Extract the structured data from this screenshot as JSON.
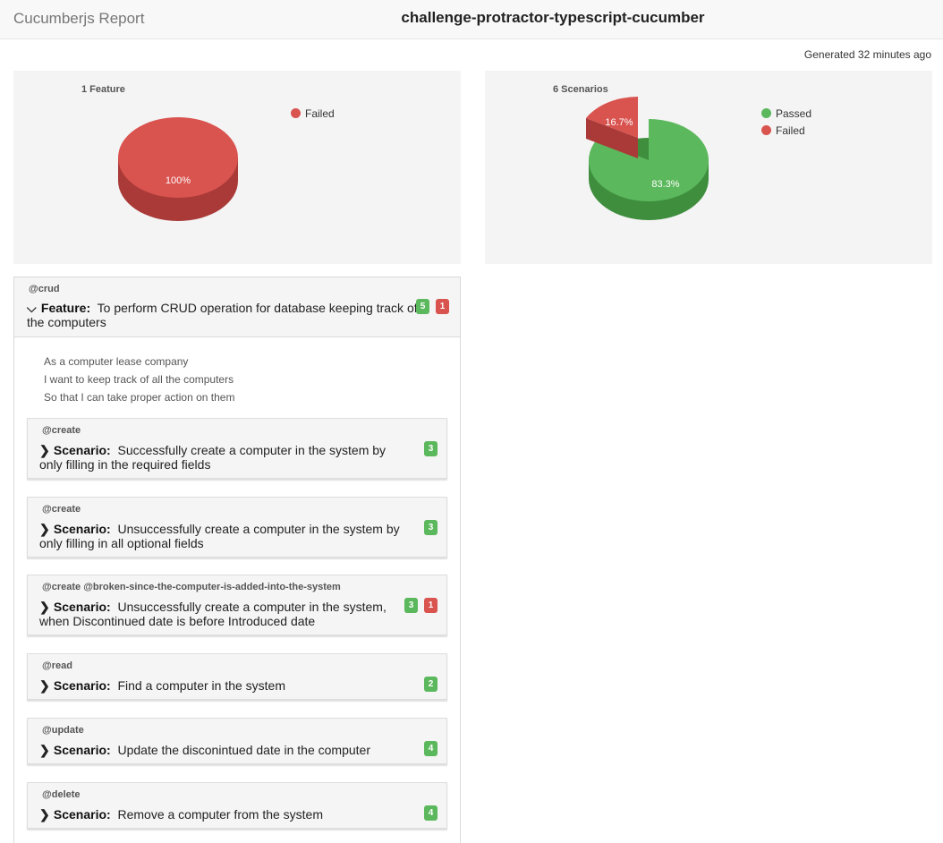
{
  "header": {
    "brand": "Cucumberjs Report",
    "title": "challenge-protractor-typescript-cucumber"
  },
  "generated": "Generated 32 minutes ago",
  "colors": {
    "passed": "#5cb85c",
    "failed": "#d9534f"
  },
  "features_chart": {
    "title": "1 Feature",
    "legend": [
      "Failed"
    ],
    "slice_label": "100%"
  },
  "scenarios_chart": {
    "title": "6 Scenarios",
    "legend": [
      "Passed",
      "Failed"
    ],
    "passed_label": "83.3%",
    "failed_label": "16.7%"
  },
  "chart_data": [
    {
      "type": "pie",
      "title": "1 Feature",
      "categories": [
        "Failed"
      ],
      "values": [
        100
      ],
      "labels": [
        "100%"
      ],
      "legend": "top-right"
    },
    {
      "type": "pie",
      "title": "6 Scenarios",
      "categories": [
        "Passed",
        "Failed"
      ],
      "values": [
        83.3,
        16.7
      ],
      "labels": [
        "83.3%",
        "16.7%"
      ],
      "legend": "top-right"
    }
  ],
  "feature": {
    "tag": "@crud",
    "keyword": "Feature:",
    "name": "To perform CRUD operation for database keeping track of the computers",
    "passed": "5",
    "failed": "1",
    "description": [
      "As a computer lease company",
      "I want to keep track of all the computers",
      "So that I can take proper action on them"
    ]
  },
  "scenarios": [
    {
      "tag": "@create",
      "keyword": "Scenario:",
      "name": "Successfully create a computer in the system by only filling in the required fields",
      "passed": "3"
    },
    {
      "tag": "@create",
      "keyword": "Scenario:",
      "name": "Unsuccessfully create a computer in the system by only filling in all optional fields",
      "passed": "3"
    },
    {
      "tag": "@create @broken-since-the-computer-is-added-into-the-system",
      "keyword": "Scenario:",
      "name": "Unsuccessfully create a computer in the system, when Discontinued date is before Introduced date",
      "passed": "3",
      "failed": "1"
    },
    {
      "tag": "@read",
      "keyword": "Scenario:",
      "name": "Find a computer in the system",
      "passed": "2"
    },
    {
      "tag": "@update",
      "keyword": "Scenario:",
      "name": "Update the disconintued date in the computer",
      "passed": "4"
    },
    {
      "tag": "@delete",
      "keyword": "Scenario:",
      "name": "Remove a computer from the system",
      "passed": "4"
    }
  ]
}
